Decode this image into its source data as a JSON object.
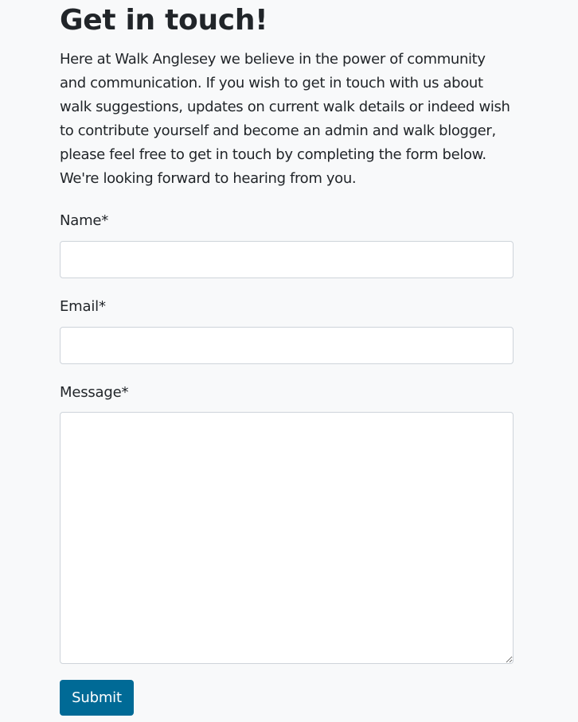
{
  "contact": {
    "heading": "Get in touch!",
    "intro": "Here at Walk Anglesey we believe in the power of community and communication. If you wish to get in touch with us about walk suggestions, updates on current walk details or indeed wish to contribute yourself and become an admin and walk blogger, please feel free to get in touch by completing the form below. We're looking forward to hearing from you.",
    "form": {
      "name_label": "Name*",
      "name_value": "",
      "email_label": "Email*",
      "email_value": "",
      "message_label": "Message*",
      "message_value": "",
      "submit_label": "Submit"
    }
  },
  "colors": {
    "page_background": "#f8f9fa",
    "text": "#212529",
    "submit_background": "#006a96",
    "input_border": "#ced4da"
  }
}
